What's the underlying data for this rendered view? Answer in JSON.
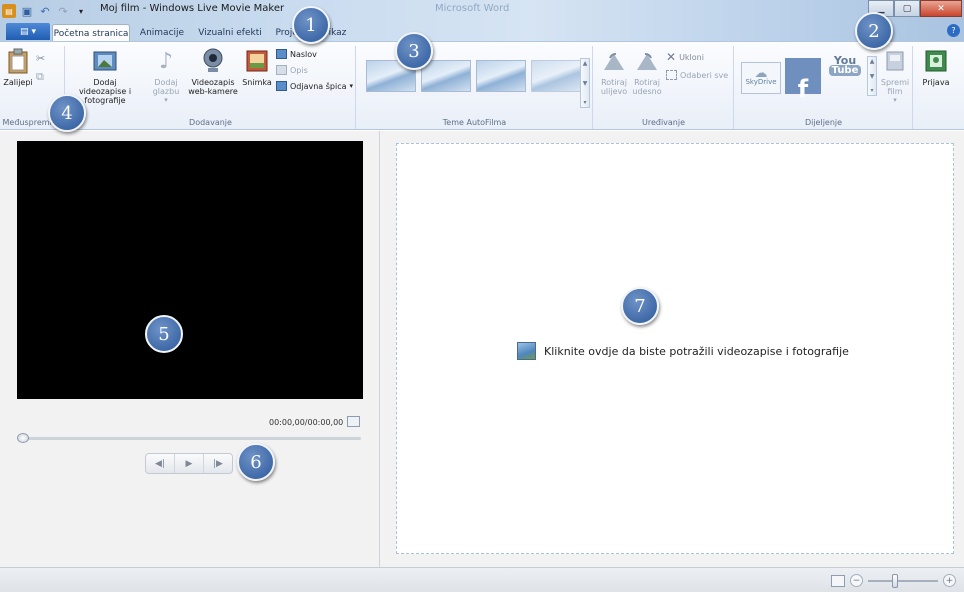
{
  "titlebar": {
    "window_title": "Moj film - Windows Live Movie Maker",
    "background_window_title": "Microsoft Word"
  },
  "tabs": [
    {
      "label": "Početna stranica",
      "active": true
    },
    {
      "label": "Animacije"
    },
    {
      "label": "Vizualni efekti"
    },
    {
      "label": "Projekt"
    },
    {
      "label": "Prikaz"
    }
  ],
  "ribbon": {
    "clipboard": {
      "group_label": "Međuspremnik",
      "paste": "Zalijepi"
    },
    "add": {
      "group_label": "Dodavanje",
      "add_videos": "Dodaj videozapise i fotografije",
      "add_music": "Dodaj glazbu",
      "webcam": "Videozapis web-kamere",
      "snapshot": "Snimka",
      "title": "Naslov",
      "caption": "Opis",
      "credits": "Odjavna špica"
    },
    "themes": {
      "group_label": "Teme AutoFilma"
    },
    "editing": {
      "group_label": "Uređivanje",
      "rotate_left": "Rotiraj ulijevo",
      "rotate_right": "Rotiraj udesno",
      "remove": "Ukloni",
      "select_all": "Odaberi sve"
    },
    "sharing": {
      "group_label": "Dijeljenje",
      "skydrive": "SkyDrive",
      "youtube_line1": "You",
      "youtube_line2": "Tube",
      "save_movie": "Spremi film",
      "signin": "Prijava"
    }
  },
  "preview": {
    "timecode": "00:00,00/00:00,00",
    "controls": [
      "◀|",
      "▶",
      "|▶"
    ]
  },
  "storyboard": {
    "prompt": "Kliknite ovdje da biste potražili videozapise i fotografije"
  },
  "markers": [
    "1",
    "2",
    "3",
    "4",
    "5",
    "6",
    "7"
  ],
  "colors": {
    "marker_fill": "#3f6aa8",
    "app_menu": "#2a69bf",
    "preview_bg": "#000000"
  }
}
